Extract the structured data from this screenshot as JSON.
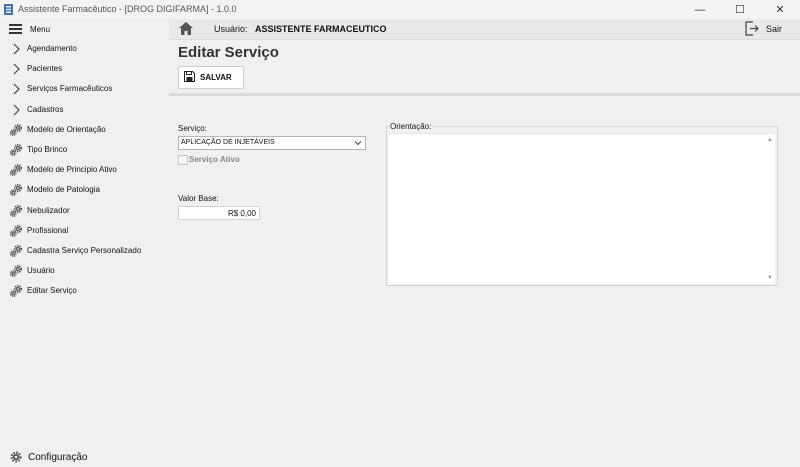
{
  "window": {
    "title": "Assistente Farmacêutico - [DROG DIGIFARMA] - 1.0.0",
    "minimize": "—",
    "maximize": "☐",
    "close": "✕"
  },
  "sidebar": {
    "menu_label": "Menu",
    "items": [
      {
        "label": "Agendamento",
        "icon": "chevron-right-icon"
      },
      {
        "label": "Pacientes",
        "icon": "chevron-right-icon"
      },
      {
        "label": "Serviços Farmacêuticos",
        "icon": "chevron-right-icon"
      },
      {
        "label": "Cadastros",
        "icon": "chevron-right-icon"
      },
      {
        "label": "Modelo de Orientação",
        "icon": "gears-icon"
      },
      {
        "label": "Tipo Brinco",
        "icon": "gears-icon"
      },
      {
        "label": "Modelo de Principio Ativo",
        "icon": "gears-icon"
      },
      {
        "label": "Modelo de Patologia",
        "icon": "gears-icon"
      },
      {
        "label": "Nebulizador",
        "icon": "gears-icon"
      },
      {
        "label": "Profissional",
        "icon": "gears-icon"
      },
      {
        "label": "Cadastra Serviço Personalizado",
        "icon": "gears-icon"
      },
      {
        "label": "Usuário",
        "icon": "gears-icon"
      },
      {
        "label": "Editar Serviço",
        "icon": "gears-icon"
      }
    ],
    "config_label": "Configuração"
  },
  "topbar": {
    "user_label": "Usuário:",
    "user_name": "ASSISTENTE FARMACEUTICO",
    "exit_label": "Sair"
  },
  "form": {
    "title": "Editar Serviço",
    "save_label": "SALVAR",
    "service_label": "Serviço:",
    "service_value": "APLICAÇÃO DE INJETÁVEIS",
    "active_label": "Serviço Ativo",
    "base_value_label": "Valor Base:",
    "base_value": "R$ 0,00",
    "orientation_label": "Orientação:"
  }
}
